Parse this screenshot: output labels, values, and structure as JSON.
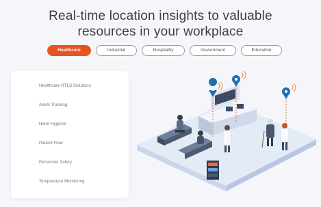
{
  "headline": {
    "line1": "Real-time location insights to valuable",
    "line2": "resources in your workplace"
  },
  "tabs": [
    {
      "label": "Healthcare",
      "active": true
    },
    {
      "label": "Industrial",
      "active": false
    },
    {
      "label": "Hospitality",
      "active": false
    },
    {
      "label": "Government",
      "active": false
    },
    {
      "label": "Education",
      "active": false
    }
  ],
  "solutions": [
    {
      "label": "Healthcare RTLS Solutions"
    },
    {
      "label": "Asset Tracking"
    },
    {
      "label": "Hand Hygiene"
    },
    {
      "label": "Patient Flow"
    },
    {
      "label": "Personnel Safety"
    },
    {
      "label": "Temperature Monitoring"
    }
  ],
  "colors": {
    "accent": "#e8541e",
    "pin": "#1f6fb2",
    "signal": "#f08a3c",
    "floor": "#dfe8f6"
  },
  "icons": [
    "location-pin-icon",
    "signal-wave-icon"
  ]
}
